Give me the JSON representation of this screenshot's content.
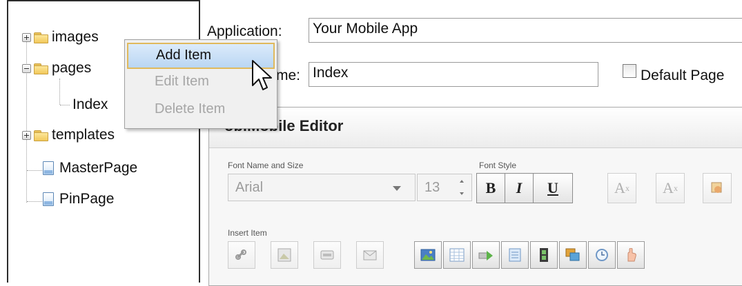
{
  "tree": {
    "items": [
      {
        "label": "images",
        "icon": "folder-icon",
        "expanded": false
      },
      {
        "label": "pages",
        "icon": "folder-icon",
        "expanded": true
      },
      {
        "label": "Index",
        "icon": "none",
        "child_of": "pages"
      },
      {
        "label": "templates",
        "icon": "folder-icon",
        "expanded": false
      },
      {
        "label": "MasterPage",
        "icon": "page-icon"
      },
      {
        "label": "PinPage",
        "icon": "page-icon"
      }
    ]
  },
  "form": {
    "application_label": "Application:",
    "application_value": "Your Mobile App",
    "name_label": "me:",
    "name_value": "Index",
    "default_page_label": "Default Page"
  },
  "context_menu": {
    "items": [
      {
        "label": "Add Item",
        "state": "highlighted"
      },
      {
        "label": "Edit Item",
        "state": "disabled"
      },
      {
        "label": "Delete Item",
        "state": "disabled"
      }
    ]
  },
  "editor": {
    "title": "obiMobile Editor",
    "font_group_label": "Font Name and Size",
    "font_name": "Arial",
    "font_size": "13",
    "style_group_label": "Font Style",
    "style_buttons": [
      "B",
      "I",
      "U"
    ],
    "script_buttons": [
      {
        "base": "A",
        "mark": "x"
      },
      {
        "base": "A",
        "mark": "x"
      }
    ],
    "insert_group_label": "Insert Item",
    "insert_buttons": [
      "link-icon",
      "image-placeholder-icon",
      "button-placeholder-icon",
      "email-placeholder-icon",
      "picture-icon",
      "table-icon",
      "navigate-icon",
      "form-icon",
      "film-icon",
      "gallery-icon",
      "clock-icon",
      "hand-icon"
    ]
  },
  "colors": {
    "menu_highlight_border": "#e0b95c",
    "menu_highlight_fill": "#bad6f3",
    "folder_yellow": "#f2c85b",
    "page_blue": "#8fb7e2"
  }
}
